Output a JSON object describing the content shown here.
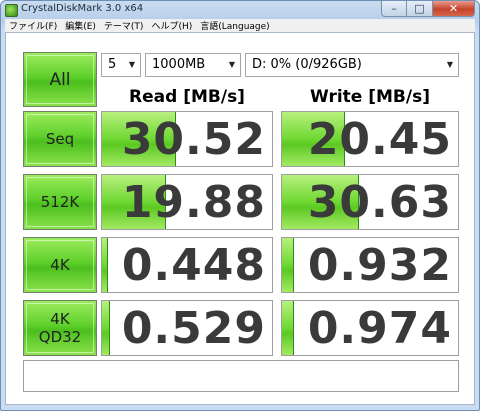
{
  "window": {
    "title": "CrystalDiskMark 3.0 x64",
    "minimize_icon": "minimize-icon",
    "maximize_icon": "maximize-icon",
    "close_icon": "close-icon"
  },
  "menu": [
    "ファイル(F)",
    "編集(E)",
    "テーマ(T)",
    "ヘルプ(H)",
    "言語(Language)"
  ],
  "controls": {
    "all_label": "All",
    "runs": "5",
    "size": "1000MB",
    "drive": "D: 0% (0/926GB)"
  },
  "headers": {
    "read": "Read [MB/s]",
    "write": "Write [MB/s]"
  },
  "rows": [
    {
      "label": "Seq",
      "read": "30.52",
      "write": "20.45",
      "read_fill": 0.43,
      "write_fill": 0.35
    },
    {
      "label": "512K",
      "read": "19.88",
      "write": "30.63",
      "read_fill": 0.37,
      "write_fill": 0.43
    },
    {
      "label": "4K",
      "read": "0.448",
      "write": "0.932",
      "read_fill": 0.03,
      "write_fill": 0.06
    },
    {
      "label": "4K\nQD32",
      "read": "0.529",
      "write": "0.974",
      "read_fill": 0.04,
      "write_fill": 0.06
    }
  ],
  "status": "",
  "colors": {
    "accent_green": "#5ed02a",
    "value_text": "#3a3a3a"
  }
}
